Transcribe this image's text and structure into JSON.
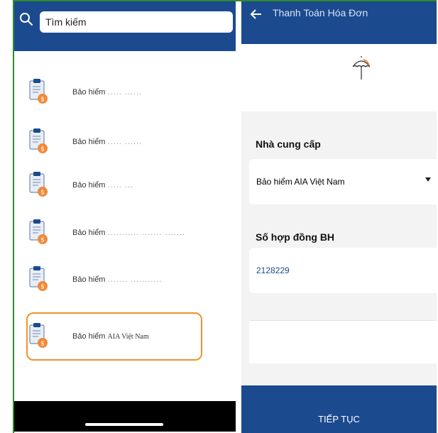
{
  "search": {
    "placeholder": "Tìm kiếm",
    "value": "Tìm kiếm"
  },
  "providers": [
    {
      "name": "Bảo hiểm",
      "suffix": "..... ......"
    },
    {
      "name": "Bảo hiểm",
      "suffix": "..... ......"
    },
    {
      "name": "Bảo hiểm",
      "suffix": "..... ..."
    },
    {
      "name": "Bảo hiểm",
      "suffix": "........... ....... ......."
    },
    {
      "name": "Bảo hiểm",
      "suffix": "....... ..........."
    },
    {
      "name": "Bảo hiểm",
      "suffix": "AIA Việt Nam"
    }
  ],
  "payment": {
    "title": "Thanh Toán Hóa Đơn",
    "provider_label": "Nhà cung cấp",
    "provider_value": "Bảo hiểm AIA Việt Nam",
    "contract_label": "Số hợp đồng BH",
    "contract_value": "2128229",
    "continue_label": "TIẾP TỤC"
  },
  "icons": {
    "search": "search-icon",
    "back": "arrow-left-icon",
    "umbrella": "umbrella-icon",
    "clipboard": "clipboard-money-icon",
    "caret": "caret-down-icon"
  },
  "colors": {
    "header": "#1b4a8f",
    "highlight": "#f0922a",
    "icon_orange": "#f08a3a"
  }
}
